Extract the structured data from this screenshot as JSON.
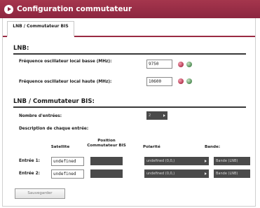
{
  "window": {
    "title": "Configuration commutateur"
  },
  "tabs": [
    {
      "label": "LNB / Commutateur BIS"
    }
  ],
  "lnb": {
    "heading": "LNB:",
    "low_label": "Fréquence oscillateur local basse (MHz):",
    "low_value": "9750",
    "high_label": "Fréquence oscillateur local haute (MHz):",
    "high_value": "10600"
  },
  "bis": {
    "heading": "LNB / Commutateur BIS:",
    "count_label": "Nombre d'entrées:",
    "count_value": "2",
    "desc_label": "Description de chaque entrée:",
    "columns": {
      "satellite": "Satellite",
      "position": "Position Commutateur BIS",
      "polarity": "Polarité",
      "band": "Bande:"
    },
    "rows": [
      {
        "label": "Entrée 1:",
        "satellite": "undefined",
        "polarity": "undefined (0,0,)",
        "band": "Bande (LNB)"
      },
      {
        "label": "Entrée 2:",
        "satellite": "undefined",
        "polarity": "undefined (0,0,)",
        "band": "Bande (LNB)"
      }
    ]
  },
  "buttons": {
    "apply": "Sauvegarder"
  },
  "colors": {
    "titlebar": "#9a2b43",
    "accent": "#9a2b43",
    "select_bg": "#4a4a4a"
  }
}
